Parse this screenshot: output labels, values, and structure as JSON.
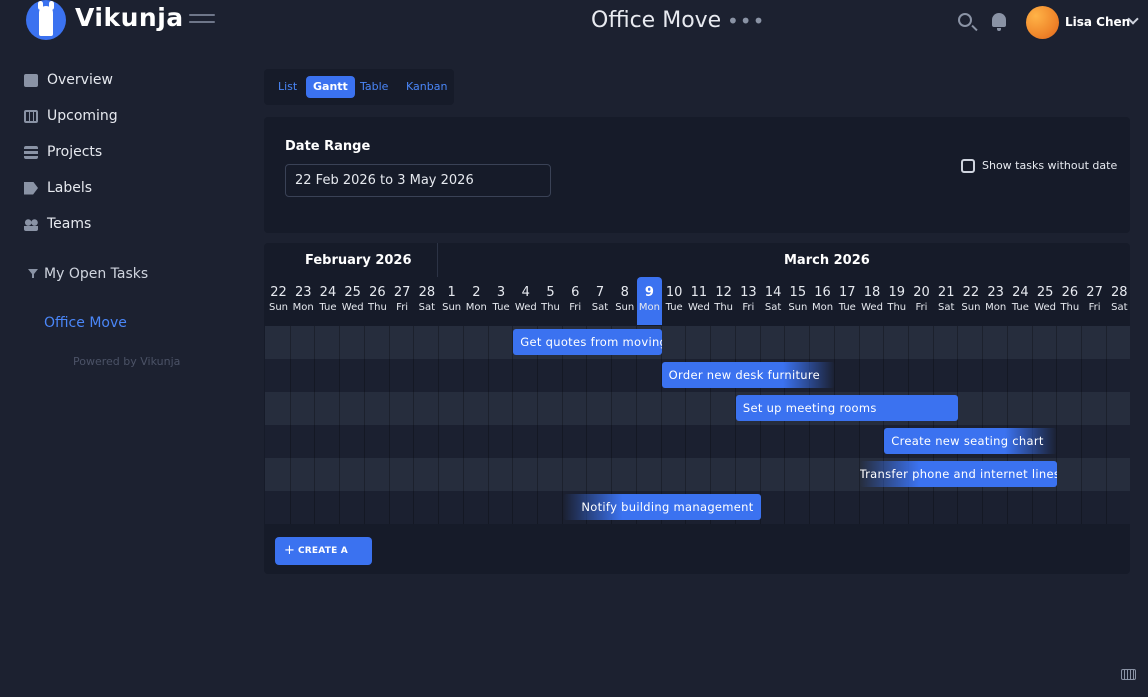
{
  "app": {
    "brand": "Vikunja"
  },
  "header": {
    "project_title": "Office Move",
    "menu_dots": "•••",
    "user_name": "Lisa Chen"
  },
  "sidebar": {
    "items": [
      {
        "label": "Overview",
        "icon": "calendar-icon"
      },
      {
        "label": "Upcoming",
        "icon": "calendar-grid-icon"
      },
      {
        "label": "Projects",
        "icon": "layers-icon"
      },
      {
        "label": "Labels",
        "icon": "tag-icon"
      },
      {
        "label": "Teams",
        "icon": "users-icon"
      }
    ],
    "filter_label": "My Open Tasks",
    "project_label": "Office Move",
    "powered_by": "Powered by Vikunja"
  },
  "views": {
    "tabs": [
      "List",
      "Gantt",
      "Table",
      "Kanban"
    ],
    "active": "Gantt"
  },
  "range": {
    "label": "Date Range",
    "value": "22 Feb 2026 to 3 May 2026",
    "show_without_date_label": "Show tasks without date",
    "show_without_date_checked": false
  },
  "gantt": {
    "months": [
      "February 2026",
      "March 2026"
    ],
    "days": [
      {
        "num": "22",
        "name": "Sun"
      },
      {
        "num": "23",
        "name": "Mon"
      },
      {
        "num": "24",
        "name": "Tue"
      },
      {
        "num": "25",
        "name": "Wed"
      },
      {
        "num": "26",
        "name": "Thu"
      },
      {
        "num": "27",
        "name": "Fri"
      },
      {
        "num": "28",
        "name": "Sat"
      },
      {
        "num": "1",
        "name": "Sun"
      },
      {
        "num": "2",
        "name": "Mon"
      },
      {
        "num": "3",
        "name": "Tue"
      },
      {
        "num": "4",
        "name": "Wed"
      },
      {
        "num": "5",
        "name": "Thu"
      },
      {
        "num": "6",
        "name": "Fri"
      },
      {
        "num": "7",
        "name": "Sat"
      },
      {
        "num": "8",
        "name": "Sun"
      },
      {
        "num": "9",
        "name": "Mon"
      },
      {
        "num": "10",
        "name": "Tue"
      },
      {
        "num": "11",
        "name": "Wed"
      },
      {
        "num": "12",
        "name": "Thu"
      },
      {
        "num": "13",
        "name": "Fri"
      },
      {
        "num": "14",
        "name": "Sat"
      },
      {
        "num": "15",
        "name": "Sun"
      },
      {
        "num": "16",
        "name": "Mon"
      },
      {
        "num": "17",
        "name": "Tue"
      },
      {
        "num": "18",
        "name": "Wed"
      },
      {
        "num": "19",
        "name": "Thu"
      },
      {
        "num": "20",
        "name": "Fri"
      },
      {
        "num": "21",
        "name": "Sat"
      },
      {
        "num": "22",
        "name": "Sun"
      },
      {
        "num": "23",
        "name": "Mon"
      },
      {
        "num": "24",
        "name": "Tue"
      },
      {
        "num": "25",
        "name": "Wed"
      },
      {
        "num": "26",
        "name": "Thu"
      },
      {
        "num": "27",
        "name": "Fri"
      },
      {
        "num": "28",
        "name": "Sat"
      }
    ],
    "today_num": "9",
    "tasks": [
      {
        "title": "Get quotes from moving companies",
        "start": "2026-03-04",
        "end": "2026-03-09"
      },
      {
        "title": "Order new desk furniture",
        "start": "2026-03-10",
        "end": "2026-03-16"
      },
      {
        "title": "Set up meeting rooms",
        "start": "2026-03-13",
        "end": "2026-03-21"
      },
      {
        "title": "Create new seating chart",
        "start": "2026-03-19",
        "end": "2026-03-25"
      },
      {
        "title": "Transfer phone and internet lines",
        "start": "2026-03-18",
        "end": "2026-03-25"
      },
      {
        "title": "Notify building management",
        "start": "2026-03-06",
        "end": "2026-03-13"
      }
    ],
    "create_label": "CREATE A TASK"
  },
  "colors": {
    "accent": "#3b72f0",
    "link": "#4a86f7",
    "background": "#1c2130",
    "card": "#161b29"
  }
}
